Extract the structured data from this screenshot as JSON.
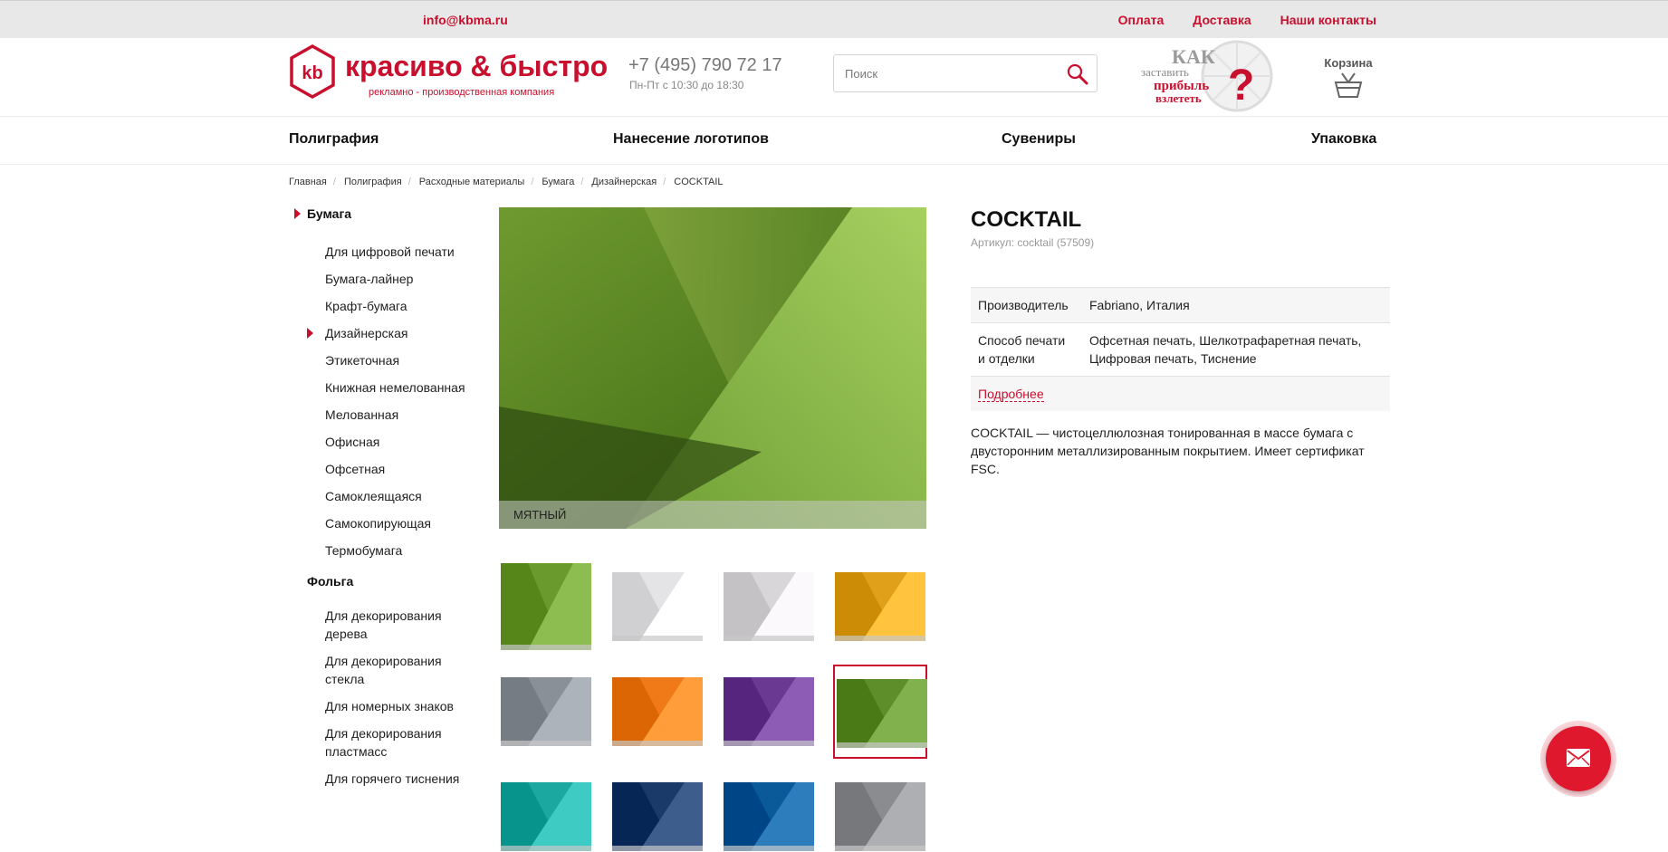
{
  "topbar": {
    "email": "info@kbma.ru",
    "links": [
      "Оплата",
      "Доставка",
      "Наши контакты"
    ]
  },
  "header": {
    "logo_mark": "kb",
    "logo_name": "красиво & быстро",
    "logo_sub": "рекламно - производственная компания",
    "phone": "+7 (495) 790 72 17",
    "hours": "Пн-Пт с 10:30 до 18:30",
    "search_placeholder": "Поиск",
    "promo": {
      "line1": "КАК",
      "line2": "заставить",
      "line3": "прибыль",
      "line4": "взлететь",
      "mark": "?"
    },
    "cart_label": "Корзина"
  },
  "nav": [
    "Полиграфия",
    "Нанесение логотипов",
    "Сувениры",
    "Упаковка"
  ],
  "breadcrumb": [
    "Главная",
    "Полиграфия",
    "Расходные материалы",
    "Бумага",
    "Дизайнерская",
    "COCKTAIL"
  ],
  "sidebar": {
    "cat1": "Бумага",
    "cat1_items": [
      "Для цифровой печати",
      "Бумага-лайнер",
      "Крафт-бумага",
      "Дизайнерская",
      "Этикеточная",
      "Книжная немелованная",
      "Мелованная",
      "Офисная",
      "Офсетная",
      "Самоклеящаяся",
      "Самокопирующая",
      "Термобумага"
    ],
    "cat2": "Фольга",
    "cat2_items": [
      "Для декорирования дерева",
      "Для декорирования стекла",
      "Для номерных знаков",
      "Для декорирования пластмасс",
      "Для горячего тиснения"
    ]
  },
  "gallery": {
    "caption": "МЯТНЫЙ",
    "thumb_colors": [
      "#6a9a2e",
      "#e4e4e6",
      "#d8d6d8",
      "#e0a01a",
      "#8a9098",
      "#f07a18",
      "#6a3a92",
      "#5e8e2a",
      "#1aa8a0",
      "#1a3a6a",
      "#0a5a9a",
      "#8a8c90"
    ]
  },
  "product": {
    "title": "COCKTAIL",
    "sku": "Артикул: cocktail (57509)",
    "spec1_label": "Производитель",
    "spec1_value": "Fabriano, Италия",
    "spec2_label": "Способ печати и отделки",
    "spec2_value": "Офсетная печать, Шелкотрафаретная печать, Цифровая печать, Тиснение",
    "more": "Подробнее",
    "description": "COCKTAIL — чистоцеллюлозная тонированная в массе бумага с двусторонним металлизированным покрытием. Имеет сертификат FSC."
  },
  "colors": {
    "brand": "#c8102e",
    "fab": "#e0182d"
  },
  "icons": {
    "search": "search-icon",
    "cart": "basket-icon",
    "mail": "mail-icon"
  }
}
